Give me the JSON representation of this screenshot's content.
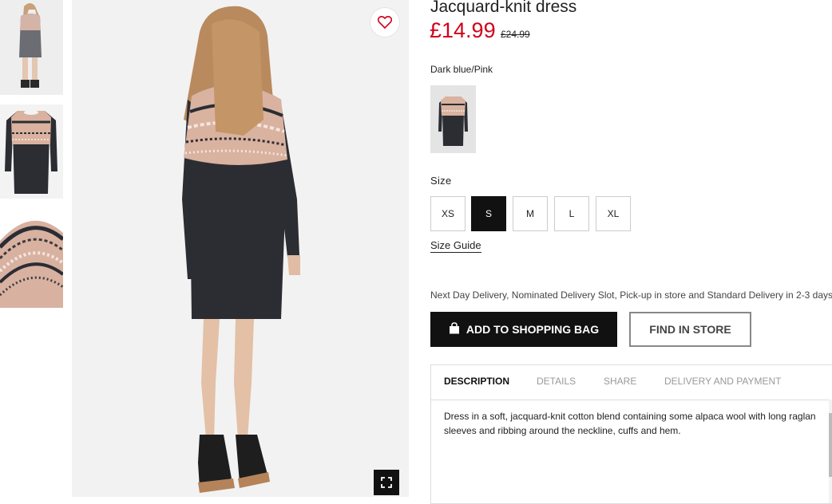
{
  "product": {
    "title": "Jacquard-knit dress",
    "price": "£14.99",
    "old_price": "£24.99",
    "color_name": "Dark blue/Pink"
  },
  "size": {
    "label": "Size",
    "options": [
      "XS",
      "S",
      "M",
      "L",
      "XL"
    ],
    "selected": "S",
    "guide_label": "Size Guide"
  },
  "delivery_note": "Next Day Delivery, Nominated Delivery Slot, Pick-up in store and Standard Delivery in 2-3 days.",
  "actions": {
    "add_to_bag": "ADD TO SHOPPING BAG",
    "find_in_store": "FIND IN STORE"
  },
  "tabs": [
    {
      "label": "DESCRIPTION",
      "active": true
    },
    {
      "label": "DETAILS",
      "active": false
    },
    {
      "label": "SHARE",
      "active": false
    },
    {
      "label": "DELIVERY AND PAYMENT",
      "active": false
    }
  ],
  "description": "Dress in a soft, jacquard-knit cotton blend containing some alpaca wool with long raglan sleeves and ribbing around the neckline, cuffs and hem.",
  "icons": {
    "favorite": "heart-icon",
    "expand": "expand-icon",
    "bag": "shopping-bag-icon"
  },
  "colors": {
    "price_red": "#d0021b",
    "dress_dark": "#2b2d33",
    "yoke_pink": "#d9b2a0"
  }
}
